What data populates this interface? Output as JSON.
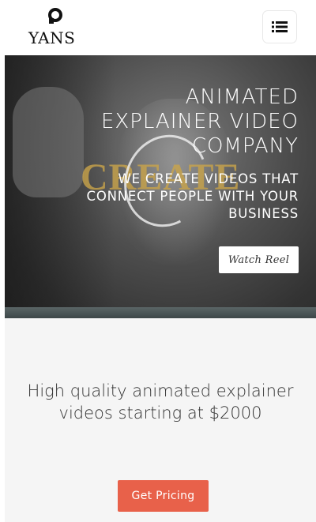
{
  "header": {
    "logo_text": "YANS",
    "menu_icon": "list-icon"
  },
  "hero": {
    "title_lines": [
      "ANIMATED",
      "EXPLAINER VIDEO",
      "COMPANY"
    ],
    "subtitle_lines": [
      "WE CREATE VIDEOS THAT",
      "CONNECT PEOPLE WITH YOUR",
      "BUSINESS"
    ],
    "watermark_text": "CREATE",
    "watch_label": "Watch Reel"
  },
  "intro": {
    "text_lines": [
      "High quality animated explainer",
      "videos starting at $2000"
    ],
    "pricing_label": "Get Pricing"
  },
  "colors": {
    "accent": "#e8614a",
    "watermark": "#c9a44a",
    "section_bg": "#f5f5f5"
  }
}
